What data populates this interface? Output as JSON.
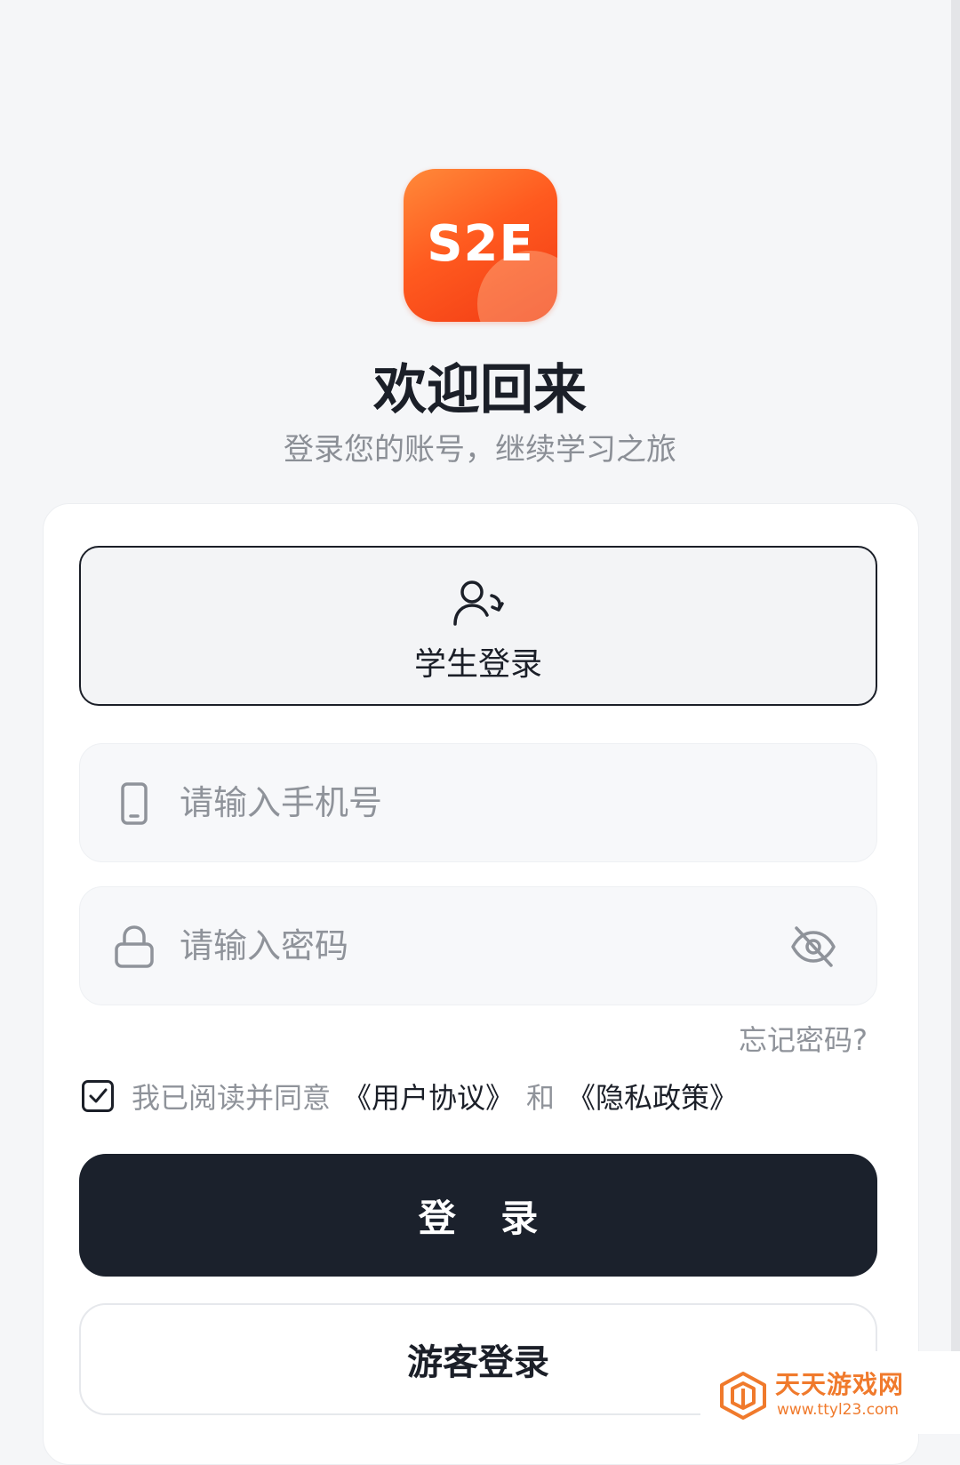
{
  "app": {
    "logo_text": "S2E",
    "title": "欢迎回来",
    "subtitle": "登录您的账号，继续学习之旅"
  },
  "role": {
    "label": "学生登录",
    "icon": "user-switch-icon"
  },
  "phone_field": {
    "placeholder": "请输入手机号",
    "value": "",
    "icon": "phone-icon"
  },
  "password_field": {
    "placeholder": "请输入密码",
    "value": "",
    "icon": "lock-icon",
    "toggle_icon": "eye-off-icon"
  },
  "forgot_password": "忘记密码?",
  "agreement": {
    "checked": true,
    "prefix": "我已阅读并同意",
    "user_agreement": "《用户协议》",
    "conjunction": "和",
    "privacy_policy": "《隐私政策》"
  },
  "buttons": {
    "login": "登 录",
    "guest": "游客登录"
  },
  "watermark": {
    "name": "天天游戏网",
    "url": "www.ttyl23.com"
  },
  "colors": {
    "brand_orange": "#ff5a1f",
    "primary_dark": "#1b212c",
    "page_bg": "#f5f6f8",
    "muted_text": "#8f939a"
  }
}
